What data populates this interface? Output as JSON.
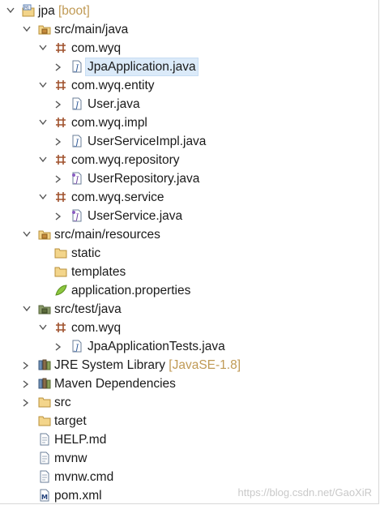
{
  "project": {
    "name": "jpa",
    "decoration": "[boot]"
  },
  "tree": {
    "src_main_java": "src/main/java",
    "pkg_com_wyq": "com.wyq",
    "jpa_application": "JpaApplication.java",
    "pkg_entity": "com.wyq.entity",
    "user_java": "User.java",
    "pkg_impl": "com.wyq.impl",
    "user_service_impl": "UserServiceImpl.java",
    "pkg_repository": "com.wyq.repository",
    "user_repository": "UserRepository.java",
    "pkg_service": "com.wyq.service",
    "user_service": "UserService.java",
    "src_main_resources": "src/main/resources",
    "static": "static",
    "templates": "templates",
    "app_properties": "application.properties",
    "src_test_java": "src/test/java",
    "test_pkg_com_wyq": "com.wyq",
    "jpa_app_tests": "JpaApplicationTests.java",
    "jre_library": "JRE System Library",
    "jre_decoration": "[JavaSE-1.8]",
    "maven_deps": "Maven Dependencies",
    "src": "src",
    "target": "target",
    "help_md": "HELP.md",
    "mvnw": "mvnw",
    "mvnw_cmd": "mvnw.cmd",
    "pom_xml": "pom.xml"
  },
  "icons": {
    "project": "java-project-icon",
    "source_folder": "package-folder-icon",
    "package": "package-icon",
    "java_class": "java-file-icon",
    "java_interface": "java-interface-file-icon",
    "folder": "folder-icon",
    "properties": "properties-leaf-icon",
    "library": "library-icon",
    "file": "file-icon",
    "xml": "xml-file-icon"
  },
  "colors": {
    "selection": "#dbeaf9",
    "decoration": "#c09a55",
    "package": "#a0522d"
  },
  "watermark": "https://blog.csdn.net/GaoXiR"
}
